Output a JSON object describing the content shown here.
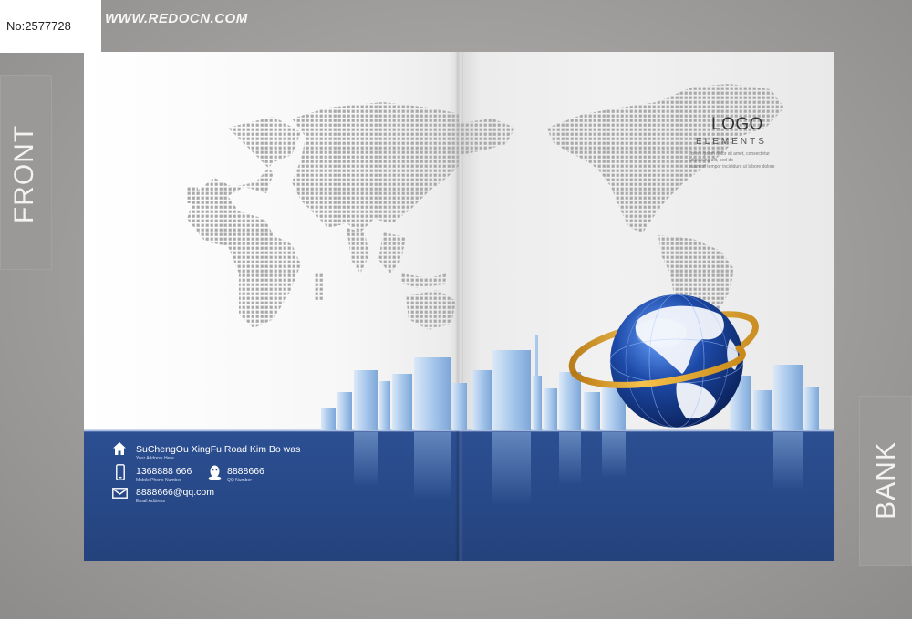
{
  "id_tag": "No:2577728",
  "site_watermark": "WWW.REDOCN.COM",
  "side_labels": {
    "front": "FRONT",
    "back": "BANK"
  },
  "logo": {
    "title": "LOGO",
    "subtitle": "ELEMENTS",
    "lorem_lines": [
      "Lorem ipsum dolor sit amet, consectetur adipisicing elit, sed do",
      "eiusmod tempor incididunt ut labore dolore"
    ]
  },
  "contact": {
    "address": {
      "main": "SuChengOu XingFu Road Kim Bo was",
      "sub": "Your Address Here",
      "icon": "home-icon"
    },
    "phone": {
      "main": "1368888 666",
      "sub": "Mobile Phone Number",
      "icon": "mobile-phone-icon"
    },
    "qq": {
      "main": "8888666",
      "sub": "QQ Number",
      "icon": "qq-penguin-icon"
    },
    "email": {
      "main": "8888666@qq.com",
      "sub": "Email Address",
      "icon": "envelope-icon"
    }
  },
  "colors": {
    "band_blue": "#274886",
    "globe_blue": "#1d4aa8",
    "ring_gold": "#e5a623",
    "building_blue": "#9fc3ea",
    "backdrop_grey": "#a4a2a1"
  }
}
